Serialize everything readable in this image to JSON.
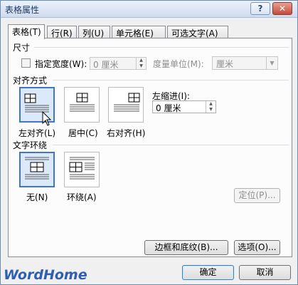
{
  "window": {
    "title": "表格属性",
    "help_label": "?",
    "close_label": "✕"
  },
  "tabs": [
    {
      "label": "表格(T)"
    },
    {
      "label": "行(R)"
    },
    {
      "label": "列(U)"
    },
    {
      "label": "单元格(E)"
    },
    {
      "label": "可选文字(A)"
    }
  ],
  "size": {
    "heading": "尺寸",
    "preferred_width_label": "指定宽度(W):",
    "preferred_width_value": "0 厘米",
    "measure_in_label": "度量单位(M):",
    "measure_in_value": "厘米"
  },
  "alignment": {
    "heading": "对齐方式",
    "options": [
      {
        "label": "左对齐(L)",
        "selected": true
      },
      {
        "label": "居中(C)",
        "selected": false
      },
      {
        "label": "右对齐(H)",
        "selected": false
      }
    ],
    "indent_label": "左缩进(I):",
    "indent_value": "0 厘米"
  },
  "text_wrapping": {
    "heading": "文字环绕",
    "options": [
      {
        "label": "无(N)",
        "selected": true
      },
      {
        "label": "环绕(A)",
        "selected": false
      }
    ],
    "positioning_label": "定位(P)..."
  },
  "buttons": {
    "borders_label": "边框和底纹(B)...",
    "options_label": "选项(O)...",
    "ok_label": "确定",
    "cancel_label": "取消"
  },
  "watermark": "WordHome",
  "colors": {
    "selection_border": "#3f77c8",
    "selection_fill": "#dbe9fb",
    "watermark": "#2f5fb4"
  }
}
